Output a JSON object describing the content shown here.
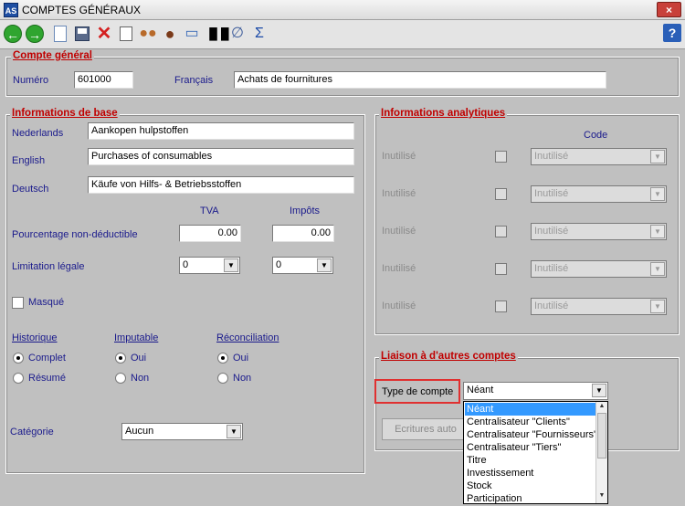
{
  "window": {
    "title": "COMPTES GÉNÉRAUX",
    "app_icon": "AS",
    "close": "×"
  },
  "toolbar": {
    "items": [
      "back-icon",
      "forward-icon",
      "new-document-icon",
      "save-icon",
      "delete-icon",
      "preview-icon",
      "users-icon",
      "user-icon",
      "book-icon",
      "chart-icon",
      "attachment-icon",
      "sum-icon",
      "help-icon"
    ],
    "sigma": "Σ",
    "help": "?"
  },
  "compte_general": {
    "title": "Compte général",
    "numero_label": "Numéro",
    "numero": "601000",
    "francais_label": "Français",
    "francais": "Achats de fournitures"
  },
  "info_base": {
    "title": "Informations de base",
    "nederlands_label": "Nederlands",
    "nederlands": "Aankopen hulpstoffen",
    "english_label": "English",
    "english": "Purchases of consumables",
    "deutsch_label": "Deutsch",
    "deutsch": "Käufe von Hilfs- & Betriebsstoffen",
    "tva_label": "TVA",
    "impots_label": "Impôts",
    "pct_label": "Pourcentage non-déductible",
    "tva_pct": "0.00",
    "impots_pct": "0.00",
    "limitation_label": "Limitation légale",
    "tva_limit": "0",
    "impots_limit": "0",
    "masque_label": "Masqué",
    "historique_label": "Historique",
    "complet": "Complet",
    "resume": "Résumé",
    "imputable_label": "Imputable",
    "oui": "Oui",
    "non": "Non",
    "reconciliation_label": "Réconciliation",
    "categorie_label": "Catégorie",
    "categorie": "Aucun"
  },
  "analytique": {
    "title": "Informations analytiques",
    "code_label": "Code",
    "rows": [
      {
        "label": "Inutilisé",
        "value": "Inutilisé"
      },
      {
        "label": "Inutilisé",
        "value": "Inutilisé"
      },
      {
        "label": "Inutilisé",
        "value": "Inutilisé"
      },
      {
        "label": "Inutilisé",
        "value": "Inutilisé"
      },
      {
        "label": "Inutilisé",
        "value": "Inutilisé"
      }
    ]
  },
  "liaison": {
    "title": "Liaison à d'autres comptes",
    "type_label": "Type de compte",
    "type_value": "Néant",
    "ecritures_button": "Ecritures auto",
    "options": [
      "Néant",
      "Centralisateur \"Clients\"",
      "Centralisateur \"Fournisseurs\"",
      "Centralisateur \"Tiers\"",
      "Titre",
      "Investissement",
      "Stock",
      "Participation"
    ]
  },
  "colors": {
    "title_red": "#c00000",
    "label_blue": "#1a1a8c",
    "selection": "#3399ff",
    "highlight_border": "#e03030"
  }
}
